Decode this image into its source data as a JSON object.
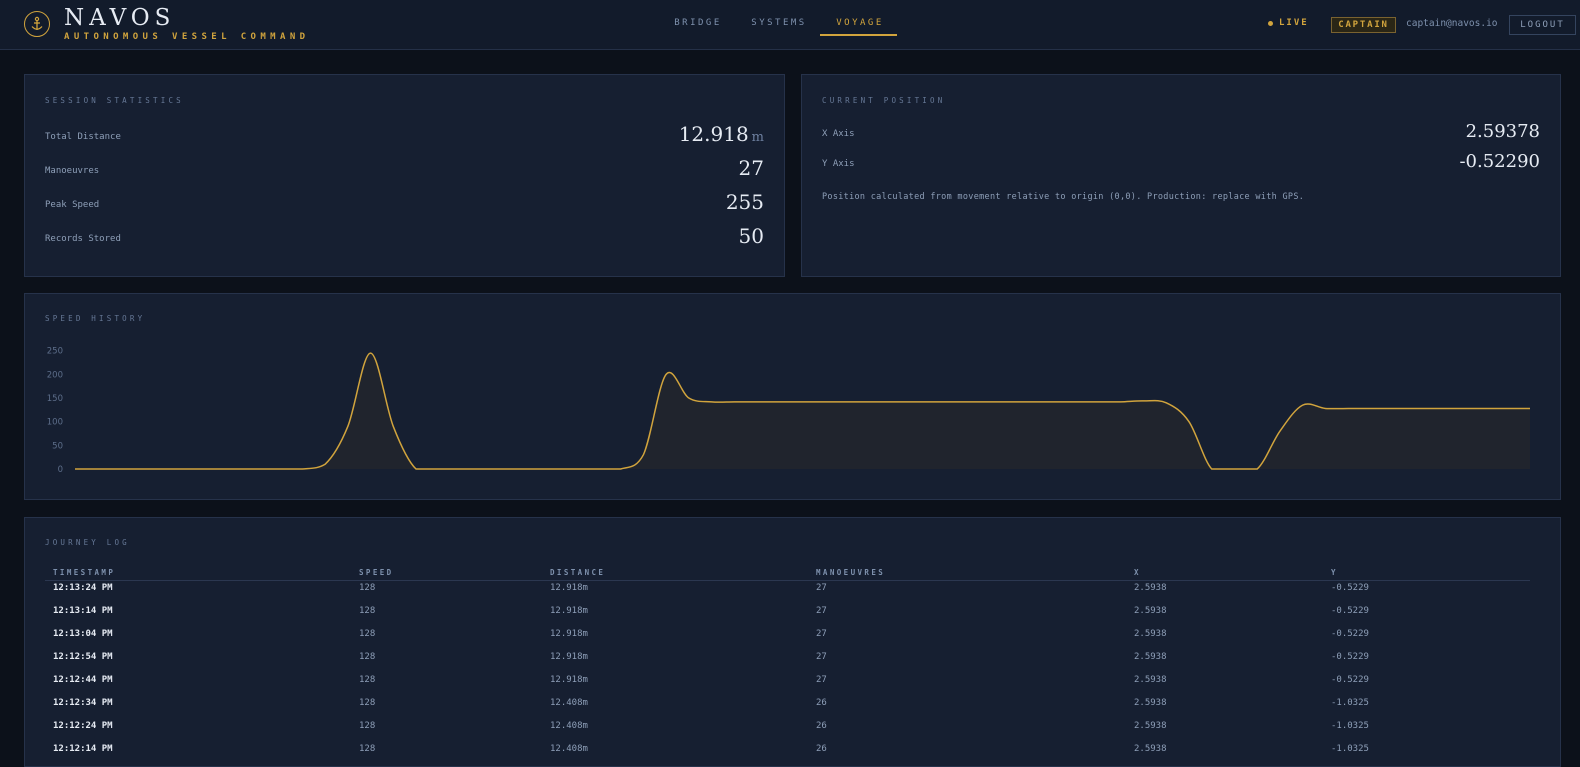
{
  "header": {
    "brand_name": "NAVOS",
    "brand_subtitle": "AUTONOMOUS VESSEL COMMAND",
    "nav": [
      "BRIDGE",
      "SYSTEMS",
      "VOYAGE"
    ],
    "active_tab": "VOYAGE",
    "live_label": "LIVE",
    "role_badge": "CAPTAIN",
    "user_email": "captain@navos.io",
    "logout_label": "LOGOUT"
  },
  "colors": {
    "accent": "#d1a43d",
    "background": "#0c111a",
    "panel": "#161f31",
    "text_primary": "#e6ebf3",
    "text_muted": "#8e9fb8"
  },
  "icons": {
    "logo": "anchor-icon",
    "live": "status-dot-icon"
  },
  "session": {
    "title": "SESSION STATISTICS",
    "stats": [
      {
        "label": "Total Distance",
        "value": "12.918",
        "unit": "m"
      },
      {
        "label": "Manoeuvres",
        "value": "27",
        "unit": ""
      },
      {
        "label": "Peak Speed",
        "value": "255",
        "unit": ""
      },
      {
        "label": "Records Stored",
        "value": "50",
        "unit": ""
      }
    ]
  },
  "position": {
    "title": "CURRENT POSITION",
    "x_label": "X Axis",
    "x_value": "2.59378",
    "y_label": "Y Axis",
    "y_value": "-0.52290",
    "note": "Position calculated from movement relative to origin (0,0). Production: replace with GPS."
  },
  "speed_chart": {
    "title": "SPEED HISTORY"
  },
  "chart_data": {
    "type": "area",
    "title": "SPEED HISTORY",
    "xlabel": "",
    "ylabel": "",
    "ylim": [
      0,
      260
    ],
    "y_ticks": [
      0,
      50,
      100,
      150,
      200,
      250
    ],
    "grid": false,
    "series": [
      {
        "values": [
          0,
          0,
          0,
          0,
          0,
          0,
          0,
          0,
          0,
          0,
          0,
          10,
          90,
          245,
          90,
          0,
          0,
          0,
          0,
          0,
          0,
          0,
          0,
          0,
          0,
          30,
          200,
          150,
          142,
          142,
          142,
          142,
          142,
          142,
          142,
          142,
          142,
          142,
          142,
          142,
          142,
          142,
          142,
          142,
          142,
          142,
          142,
          144,
          140,
          100,
          0,
          0,
          0,
          80,
          135,
          128,
          128,
          128,
          128,
          128,
          128,
          128,
          128,
          128,
          128
        ]
      }
    ]
  },
  "journey_log": {
    "title": "JOURNEY LOG",
    "columns": [
      "TIMESTAMP",
      "SPEED",
      "DISTANCE",
      "MANOEUVRES",
      "X",
      "Y"
    ],
    "rows": [
      [
        "12:13:24 PM",
        "128",
        "12.918m",
        "27",
        "2.5938",
        "-0.5229"
      ],
      [
        "12:13:14 PM",
        "128",
        "12.918m",
        "27",
        "2.5938",
        "-0.5229"
      ],
      [
        "12:13:04 PM",
        "128",
        "12.918m",
        "27",
        "2.5938",
        "-0.5229"
      ],
      [
        "12:12:54 PM",
        "128",
        "12.918m",
        "27",
        "2.5938",
        "-0.5229"
      ],
      [
        "12:12:44 PM",
        "128",
        "12.918m",
        "27",
        "2.5938",
        "-0.5229"
      ],
      [
        "12:12:34 PM",
        "128",
        "12.408m",
        "26",
        "2.5938",
        "-1.0325"
      ],
      [
        "12:12:24 PM",
        "128",
        "12.408m",
        "26",
        "2.5938",
        "-1.0325"
      ],
      [
        "12:12:14 PM",
        "128",
        "12.408m",
        "26",
        "2.5938",
        "-1.0325"
      ]
    ]
  }
}
